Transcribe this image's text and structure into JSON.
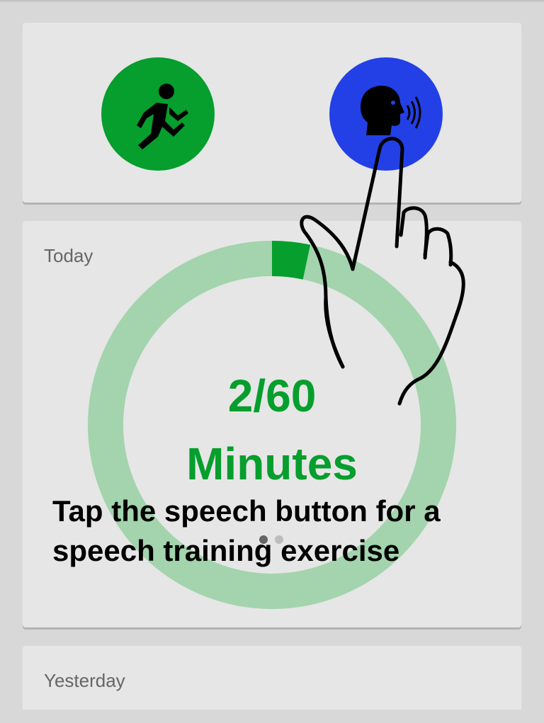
{
  "colors": {
    "exercise_button": "#069e2d",
    "speech_button": "#2340e6",
    "progress": "#069e2d",
    "ring_track": "#a3d4ad"
  },
  "actions": {
    "exercise_icon": "running-person-icon",
    "speech_icon": "speaking-head-icon"
  },
  "today": {
    "label": "Today",
    "progress_text": "2/60",
    "unit": "Minutes",
    "minutes_done": 2,
    "minutes_goal": 60
  },
  "pager": {
    "pages": 2,
    "active": 1
  },
  "yesterday": {
    "label": "Yesterday"
  },
  "overlay": {
    "hint": "Tap the speech button for a speech training exercise",
    "gesture_icon": "pointing-hand-icon"
  }
}
